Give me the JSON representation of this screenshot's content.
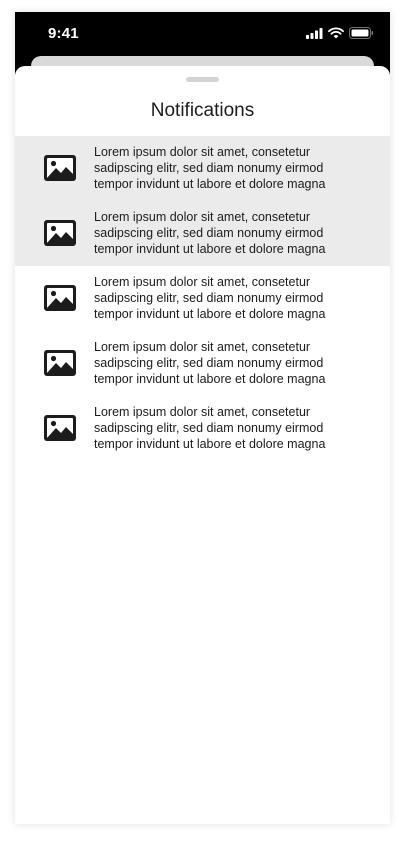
{
  "status_bar": {
    "time": "9:41",
    "icons": [
      "signal-icon",
      "wifi-icon",
      "battery-icon"
    ]
  },
  "sheet": {
    "title": "Notifications"
  },
  "notifications": [
    {
      "icon": "image-icon",
      "text": "Lorem ipsum dolor sit amet, consetetur sadipscing elitr, sed diam nonumy eirmod tempor invidunt ut labore et dolore magna",
      "highlighted": true
    },
    {
      "icon": "image-icon",
      "text": "Lorem ipsum dolor sit amet, consetetur sadipscing elitr, sed diam nonumy eirmod tempor invidunt ut labore et dolore magna",
      "highlighted": true
    },
    {
      "icon": "image-icon",
      "text": "Lorem ipsum dolor sit amet, consetetur sadipscing elitr, sed diam nonumy eirmod tempor invidunt ut labore et dolore magna",
      "highlighted": false
    },
    {
      "icon": "image-icon",
      "text": "Lorem ipsum dolor sit amet, consetetur sadipscing elitr, sed diam nonumy eirmod tempor invidunt ut labore et dolore magna",
      "highlighted": false
    },
    {
      "icon": "image-icon",
      "text": "Lorem ipsum dolor sit amet, consetetur sadipscing elitr, sed diam nonumy eirmod tempor invidunt ut labore et dolore magna",
      "highlighted": false
    }
  ],
  "colors": {
    "status_bar_bg": "#000000",
    "highlight_bg": "#ebebeb",
    "text": "#1c1c1c",
    "icon": "#1c1c1c"
  }
}
